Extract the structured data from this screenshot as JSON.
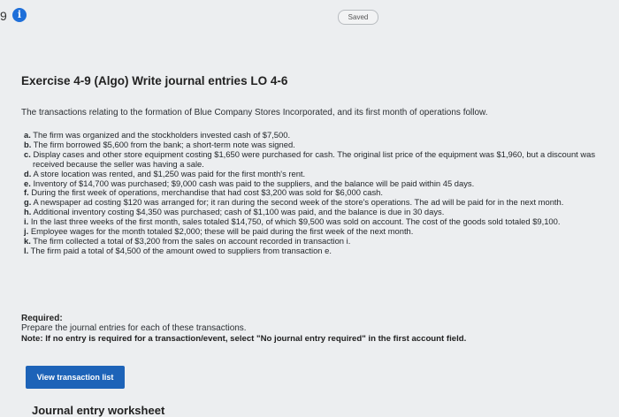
{
  "header": {
    "question_number": "9",
    "info_icon": "i",
    "saved_label": "Saved"
  },
  "exercise": {
    "title": "Exercise 4-9 (Algo) Write journal entries LO 4-6",
    "intro": "The transactions relating to the formation of Blue Company Stores Incorporated, and its first month of operations follow.",
    "transactions": [
      {
        "letter": "a.",
        "text": "The firm was organized and the stockholders invested cash of $7,500."
      },
      {
        "letter": "b.",
        "text": "The firm borrowed $5,600 from the bank; a short-term note was signed."
      },
      {
        "letter": "c.",
        "text": "Display cases and other store equipment costing $1,650 were purchased for cash. The original list price of the equipment was $1,960, but a discount was received because the seller was having a sale."
      },
      {
        "letter": "d.",
        "text": "A store location was rented, and $1,250 was paid for the first month's rent."
      },
      {
        "letter": "e.",
        "text": "Inventory of $14,700 was purchased; $9,000 cash was paid to the suppliers, and the balance will be paid within 45 days."
      },
      {
        "letter": "f.",
        "text": "During the first week of operations, merchandise that had cost $3,200 was sold for $6,000 cash."
      },
      {
        "letter": "g.",
        "text": "A newspaper ad costing $120 was arranged for; it ran during the second week of the store's operations. The ad will be paid for in the next month."
      },
      {
        "letter": "h.",
        "text": "Additional inventory costing $4,350 was purchased; cash of $1,100 was paid, and the balance is due in 30 days."
      },
      {
        "letter": "i.",
        "text": "In the last three weeks of the first month, sales totaled $14,750, of which $9,500 was sold on account. The cost of the goods sold totaled $9,100."
      },
      {
        "letter": "j.",
        "text": "Employee wages for the month totaled $2,000; these will be paid during the first week of the next month."
      },
      {
        "letter": "k.",
        "text": "The firm collected a total of $3,200 from the sales on account recorded in transaction i."
      },
      {
        "letter": "l.",
        "text": "The firm paid a total of $4,500 of the amount owed to suppliers from transaction e."
      }
    ],
    "required_label": "Required:",
    "required_text": "Prepare the journal entries for each of these transactions.",
    "note_label": "Note:",
    "note_text": "If no entry is required for a transaction/event, select \"No journal entry required\" in the first account field."
  },
  "actions": {
    "view_transaction_list": "View transaction list"
  },
  "worksheet": {
    "title": "Journal entry worksheet"
  }
}
